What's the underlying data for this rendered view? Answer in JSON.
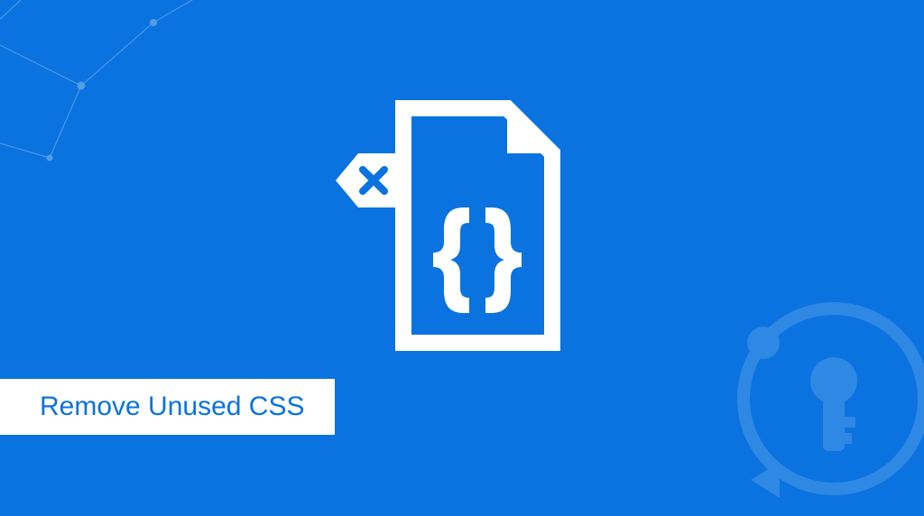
{
  "caption": "Remove Unused CSS",
  "colors": {
    "background": "#0a73e0",
    "foreground": "#ffffff"
  },
  "icons": {
    "main": "css-file-delete-icon",
    "watermark": "keycdn-logo-icon",
    "decoration": "network-nodes-icon"
  }
}
